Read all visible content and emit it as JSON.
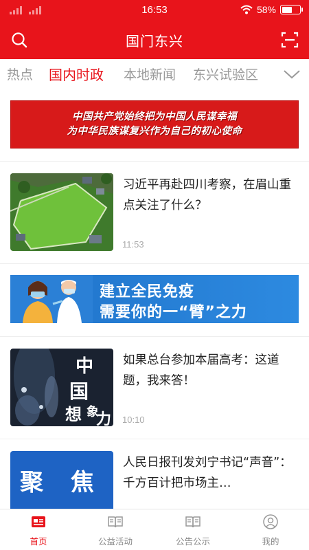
{
  "status_bar": {
    "time": "16:53",
    "battery_percent": "58%",
    "battery_level": 0.58
  },
  "header": {
    "title": "国门东兴",
    "left_icon": "search-icon",
    "right_icon": "scan-icon"
  },
  "tabs": {
    "items": [
      {
        "label": "热点"
      },
      {
        "label": "国内时政"
      },
      {
        "label": "本地新闻"
      },
      {
        "label": "东兴试验区"
      }
    ],
    "active_index": 1,
    "more_icon": "chevron-down-icon"
  },
  "banner_top": {
    "line1": "中国共产党始终把为中国人民谋幸福",
    "line2": "为中华民族谋复兴作为自己的初心使命"
  },
  "news": [
    {
      "title": "习近平再赴四川考察，在眉山重点关注了什么？",
      "time": "11:53"
    },
    {
      "title": "如果总台参加本届高考：这道题，我来答！",
      "time": "10:10",
      "thumb_text": "中国想象力"
    },
    {
      "title": "人民日报刊发刘宁书记“声音”：千方百计把市场主…",
      "thumb_text": "聚 焦"
    }
  ],
  "banner_vaccine": {
    "line1": "建立全民免疫",
    "line2": "需要你的一“臂”之力"
  },
  "bottom_nav": {
    "items": [
      {
        "label": "首页",
        "icon": "news-icon"
      },
      {
        "label": "公益活动",
        "icon": "book-icon"
      },
      {
        "label": "公告公示",
        "icon": "book-icon"
      },
      {
        "label": "我的",
        "icon": "user-icon"
      }
    ],
    "active_index": 0
  },
  "colors": {
    "brand_red": "#e8141b",
    "tab_inactive": "#9a9a9a",
    "time_gray": "#aaaaaa"
  }
}
